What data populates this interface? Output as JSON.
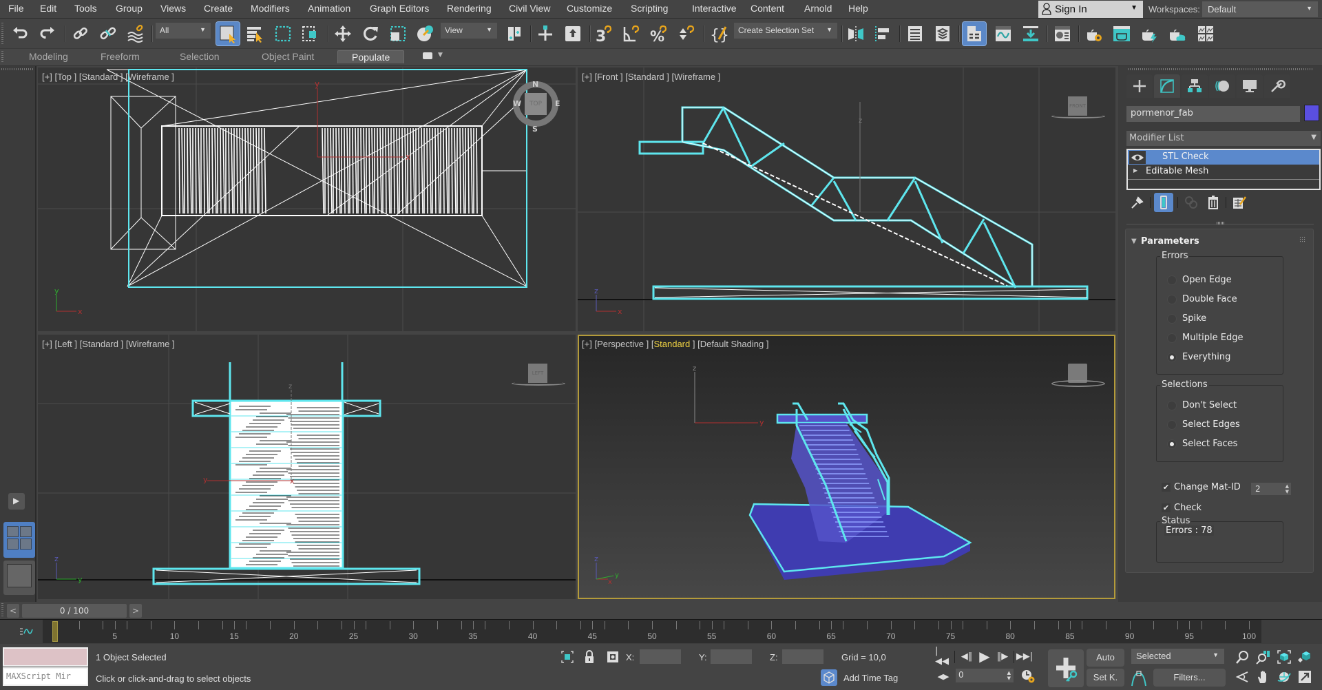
{
  "menu": {
    "items": [
      "File",
      "Edit",
      "Tools",
      "Group",
      "Views",
      "Create",
      "Modifiers",
      "Animation",
      "Graph Editors",
      "Rendering",
      "Civil View",
      "Customize",
      "Scripting",
      "Interactive",
      "Content",
      "Arnold",
      "Help"
    ],
    "sign_in": "Sign In",
    "workspaces_label": "Workspaces:",
    "workspace_value": "Default"
  },
  "toolbar": {
    "selection_filter": "All",
    "reference_coord": "View",
    "named_selection_placeholder": "Create Selection Set",
    "icons": [
      "undo-icon",
      "redo-icon",
      "link-icon",
      "unlink-icon",
      "bind-space-warp-icon",
      "select-object-icon",
      "select-by-name-icon",
      "rectangular-selection-icon",
      "window-crossing-icon",
      "move-icon",
      "rotate-icon",
      "scale-icon",
      "place-icon",
      "pivot-icon",
      "manipulate-icon",
      "keyboard-shortcut-icon",
      "snaps-3d-icon",
      "angle-snap-icon",
      "percent-snap-icon",
      "spinner-snap-icon",
      "edit-named-selection-icon",
      "mirror-icon",
      "align-icon",
      "scene-explorer-icon",
      "layer-explorer-icon",
      "toggle-ribbon-icon",
      "curve-editor-icon",
      "schematic-view-icon",
      "material-editor-icon",
      "render-setup-icon",
      "rendered-frame-window-icon",
      "render-production-icon",
      "render-cloud-icon",
      "environment-icon"
    ]
  },
  "ribbon": {
    "tabs": [
      "Modeling",
      "Freeform",
      "Selection",
      "Object Paint",
      "Populate"
    ],
    "active_tab": "Populate"
  },
  "viewports": {
    "top": {
      "bracket": "[+]",
      "view": "[Top ]",
      "mode": "[Standard ]",
      "shading": "[Wireframe ]",
      "viewcube": "TOP",
      "compass": [
        "N",
        "E",
        "S",
        "W"
      ]
    },
    "front": {
      "bracket": "[+]",
      "view": "[Front ]",
      "mode": "[Standard ]",
      "shading": "[Wireframe ]",
      "viewcube": "FRONT"
    },
    "left": {
      "bracket": "[+]",
      "view": "[Left ]",
      "mode": "[Standard ]",
      "shading": "[Wireframe ]",
      "viewcube": "LEFT"
    },
    "perspective": {
      "bracket": "[+]",
      "view": "[Perspective ]",
      "mode_pre": "[",
      "mode": "Standard",
      "mode_post": " ]",
      "shading": "[Default Shading ]",
      "active": true
    },
    "axis_labels": {
      "x": "x",
      "y": "y",
      "z": "z"
    }
  },
  "command_panel": {
    "tabs": [
      "create",
      "modify",
      "hierarchy",
      "motion",
      "display",
      "utilities"
    ],
    "active_tab": "modify",
    "object_name": "pormenor_fab",
    "object_color": "#5a4fe0",
    "modifier_list": "Modifier List",
    "stack": [
      {
        "label": "STL Check",
        "selected": true
      },
      {
        "label": "Editable Mesh",
        "selected": false
      }
    ],
    "rollout": {
      "title": "Parameters",
      "errors_group": "Errors",
      "errors": [
        {
          "label": "Open Edge",
          "checked": false
        },
        {
          "label": "Double Face",
          "checked": false
        },
        {
          "label": "Spike",
          "checked": false
        },
        {
          "label": "Multiple Edge",
          "checked": false
        },
        {
          "label": "Everything",
          "checked": true
        }
      ],
      "selections_group": "Selections",
      "selections": [
        {
          "label": "Don't Select",
          "checked": false
        },
        {
          "label": "Select Edges",
          "checked": false
        },
        {
          "label": "Select Faces",
          "checked": true
        }
      ],
      "change_mat_id_label": "Change Mat-ID",
      "change_mat_id_checked": true,
      "mat_id_value": "2",
      "check_label": "Check",
      "check_checked": true,
      "status_group": "Status",
      "status_text": "Errors : 78"
    }
  },
  "timeline": {
    "slider_text": "0 / 100",
    "prev": "<",
    "next": ">",
    "current_frame": 0,
    "start": 0,
    "end": 100,
    "labels": [
      "0",
      "5",
      "10",
      "15",
      "20",
      "25",
      "30",
      "35",
      "40",
      "45",
      "50",
      "55",
      "60",
      "65",
      "70",
      "75",
      "80",
      "85",
      "90",
      "95",
      "100"
    ]
  },
  "status": {
    "maxscript_placeholder": "MAXScript Mir",
    "selection": "1 Object Selected",
    "prompt": "Click or click-and-drag to select objects",
    "x_label": "X:",
    "y_label": "Y:",
    "z_label": "Z:",
    "x_value": "",
    "y_value": "",
    "z_value": "",
    "grid": "Grid = 10,0",
    "add_time_tag": "Add Time Tag",
    "frame_value": "0",
    "auto_key": "Auto",
    "set_key": "Set K.",
    "key_mode": "Selected",
    "filters": "Filters..."
  }
}
